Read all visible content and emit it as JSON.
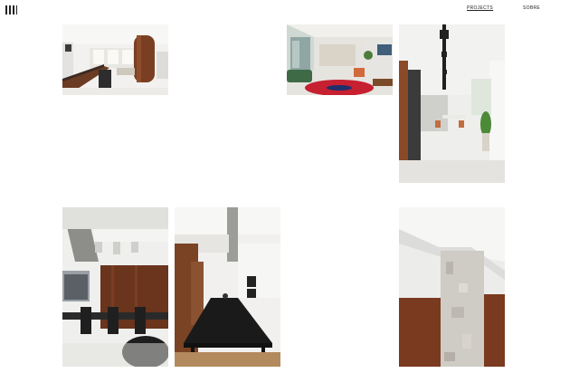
{
  "header": {
    "logo_icon": "logo-mark-icon",
    "nav": [
      {
        "label": "PROJECTS",
        "active": true
      },
      {
        "label": "SOBRE",
        "active": false
      }
    ]
  },
  "gallery": {
    "photos": [
      {
        "name": "photo-kitchen-living"
      },
      {
        "name": "photo-living-red-rug"
      },
      {
        "name": "photo-corridor-dining"
      },
      {
        "name": "photo-dining-wood-wall"
      },
      {
        "name": "photo-black-table"
      },
      {
        "name": "photo-concrete-column"
      }
    ]
  }
}
